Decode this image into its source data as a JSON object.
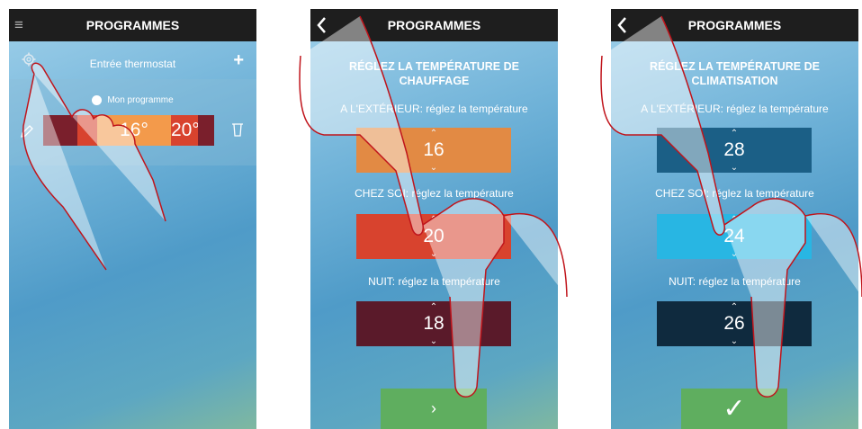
{
  "screen1": {
    "title": "PROGRAMMES",
    "menu_icon": "≡",
    "thermostat_label": "Entrée thermostat",
    "add_icon": "+",
    "program_name": "Mon programme",
    "temperatures": [
      "16°",
      "20°"
    ]
  },
  "screen2": {
    "title": "PROGRAMMES",
    "heading": "RÉGLEZ LA TEMPÉRATURE DE CHAUFFAGE",
    "outside_label": "A L'EXTÉRIEUR: réglez la température",
    "home_label": "CHEZ SOI: réglez la température",
    "night_label": "NUIT: réglez la température",
    "outside_value": "16",
    "home_value": "20",
    "night_value": "18",
    "next_label": "›",
    "colors": {
      "outside": "#e28a44",
      "home": "#d8432e",
      "night": "#5a1a2a"
    }
  },
  "screen3": {
    "title": "PROGRAMMES",
    "heading": "RÉGLEZ LA TEMPÉRATURE DE CLIMATISATION",
    "outside_label": "A L'EXTÉRIEUR: réglez la température",
    "home_label": "CHEZ SOI: réglez la température",
    "night_label": "NUIT: réglez la température",
    "outside_value": "28",
    "home_value": "24",
    "night_value": "26",
    "confirm_label": "✓",
    "colors": {
      "outside": "#1b5f86",
      "home": "#28b6e3",
      "night": "#0f2a3e"
    }
  },
  "chevron_up": "⌃",
  "chevron_down": "⌄"
}
